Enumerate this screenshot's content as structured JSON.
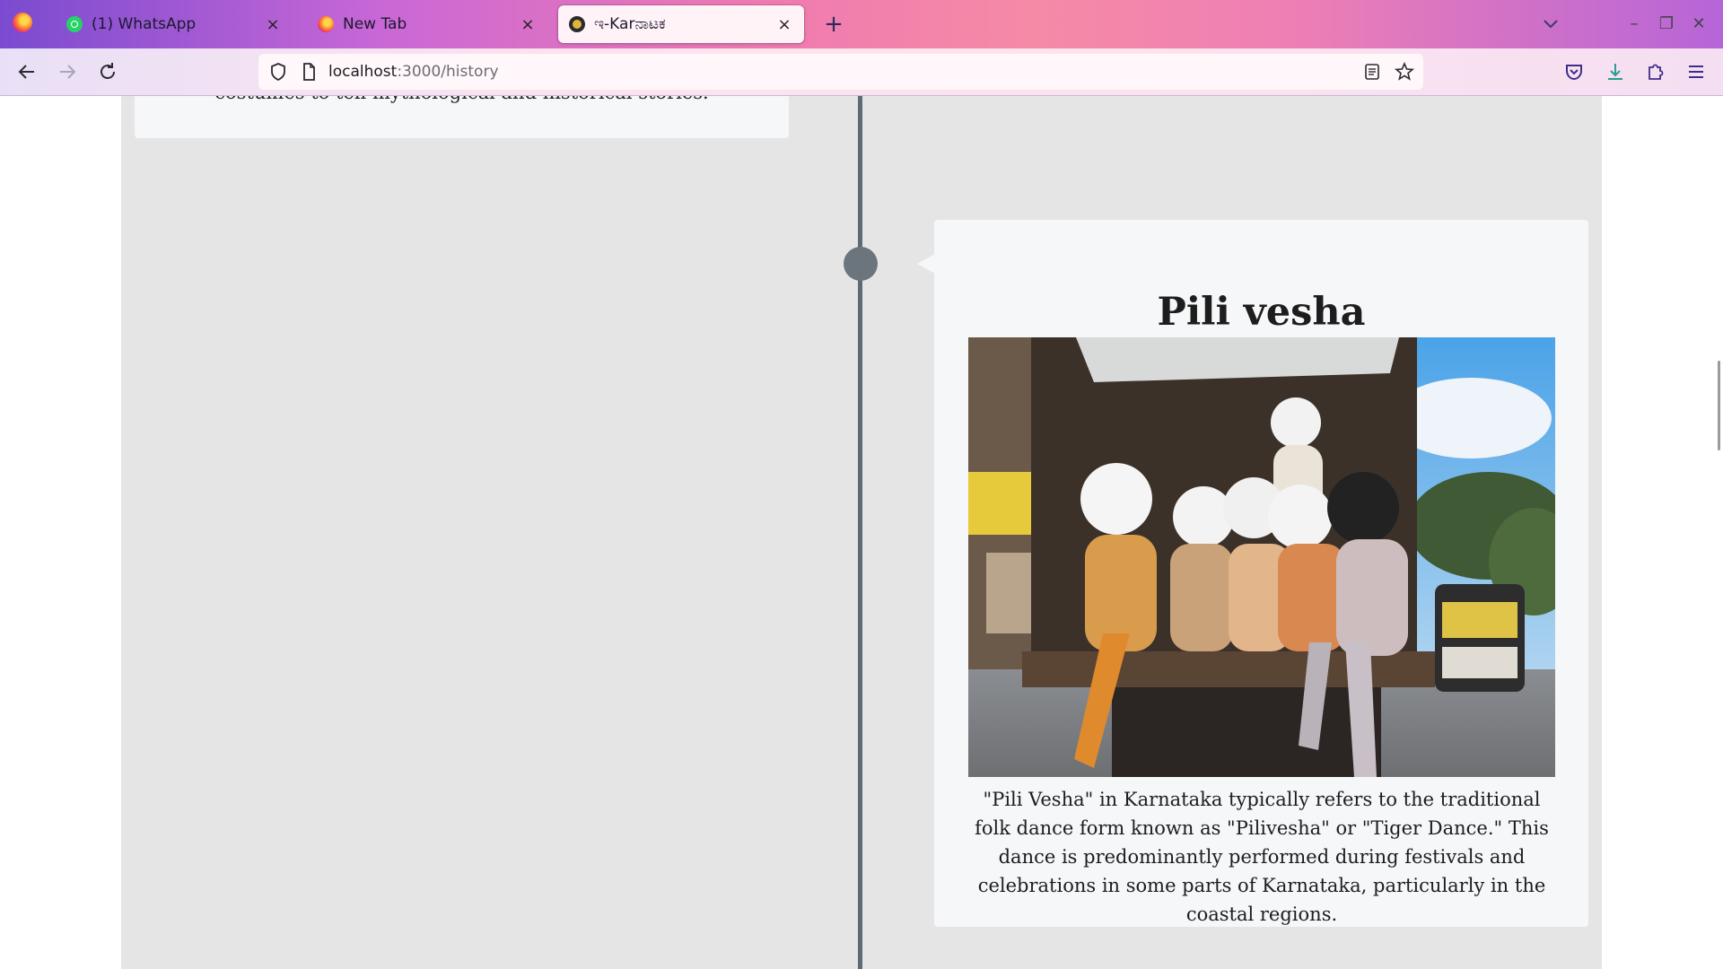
{
  "tabs": [
    {
      "label": "(1) WhatsApp",
      "favicon": "whatsapp-icon",
      "active": false
    },
    {
      "label": "New Tab",
      "favicon": "firefox-icon",
      "active": false
    },
    {
      "label": "ಇ-Karನಾಟಕ",
      "favicon": "site-icon",
      "active": true
    }
  ],
  "tab_close_glyph": "×",
  "newtab_glyph": "+",
  "window_controls": {
    "minimize": "–",
    "restore": "❐",
    "close": "✕"
  },
  "address_bar": {
    "host": "localhost",
    "path": ":3000/history"
  },
  "timeline": {
    "previous_card_text": "costumes to tell mythological and historical stories.",
    "card": {
      "title": "Pili vesha",
      "image_subject": "Pili Vesha performers in tiger body paint on a truck",
      "description": "\"Pili Vesha\" in Karnataka typically refers to the traditional folk dance form known as \"Pilivesha\" or \"Tiger Dance.\" This dance is predominantly performed during festivals and celebrations in some parts of Karnataka, particularly in the coastal regions."
    }
  },
  "colors": {
    "timeline_background": "#e5e5e5",
    "card_background": "#f6f7f9",
    "timeline_line": "#5f6b74"
  }
}
